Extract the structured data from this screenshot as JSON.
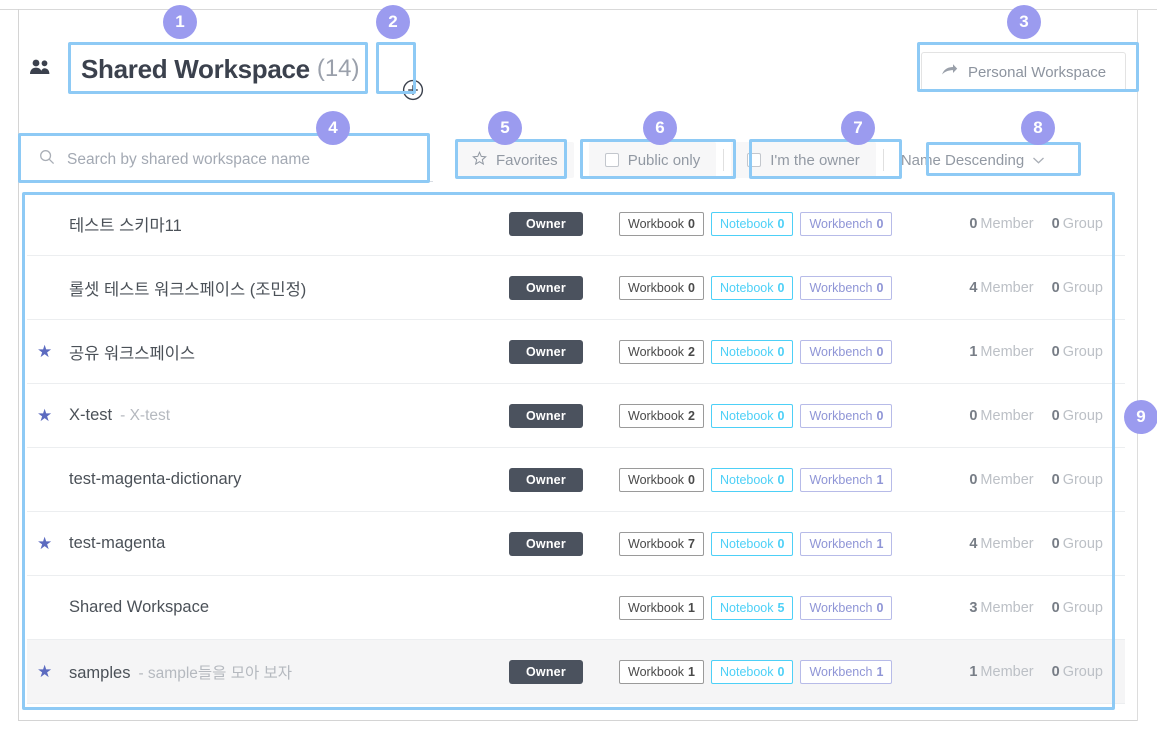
{
  "header": {
    "people_icon": "people-icon",
    "title": "Shared Workspace",
    "count": "(14)",
    "add_icon": "⊕",
    "personal_workspace_label": "Personal Workspace",
    "personal_workspace_icon": "➔"
  },
  "filters": {
    "search_placeholder": "Search by shared workspace name",
    "search_value": "",
    "search_icon": "⚲",
    "favorites_label": "Favorites",
    "favorites_icon": "☆",
    "public_only_label": "Public only",
    "public_only_checked": false,
    "im_the_owner_label": "I'm the owner",
    "im_the_owner_checked": false,
    "sort_label": "Name Descending",
    "sort_caret": "⌄"
  },
  "list": {
    "labels": {
      "workbook": "Workbook",
      "notebook": "Notebook",
      "workbench": "Workbench",
      "member": "Member",
      "group": "Group",
      "owner": "Owner",
      "star": "★"
    },
    "rows": [
      {
        "name": "테스트 스키마11",
        "desc": "",
        "favorite": false,
        "role": "Owner",
        "workbook": "0",
        "notebook": "0",
        "workbench": "0",
        "member": "0",
        "group": "0",
        "hovered": false
      },
      {
        "name": "롤셋 테스트 워크스페이스 (조민정)",
        "desc": "",
        "favorite": false,
        "role": "Owner",
        "workbook": "0",
        "notebook": "0",
        "workbench": "0",
        "member": "4",
        "group": "0",
        "hovered": false
      },
      {
        "name": "공유 워크스페이스",
        "desc": "",
        "favorite": true,
        "role": "Owner",
        "workbook": "2",
        "notebook": "0",
        "workbench": "0",
        "member": "1",
        "group": "0",
        "hovered": false
      },
      {
        "name": "X-test",
        "desc": "- X-test",
        "favorite": true,
        "role": "Owner",
        "workbook": "2",
        "notebook": "0",
        "workbench": "0",
        "member": "0",
        "group": "0",
        "hovered": false
      },
      {
        "name": "test-magenta-dictionary",
        "desc": "",
        "favorite": false,
        "role": "Owner",
        "workbook": "0",
        "notebook": "0",
        "workbench": "1",
        "member": "0",
        "group": "0",
        "hovered": false
      },
      {
        "name": "test-magenta",
        "desc": "",
        "favorite": true,
        "role": "Owner",
        "workbook": "7",
        "notebook": "0",
        "workbench": "1",
        "member": "4",
        "group": "0",
        "hovered": false
      },
      {
        "name": "Shared Workspace",
        "desc": "",
        "favorite": false,
        "role": "",
        "workbook": "1",
        "notebook": "5",
        "workbench": "0",
        "member": "3",
        "group": "0",
        "hovered": false
      },
      {
        "name": "samples",
        "desc": "- sample들을 모아 보자",
        "favorite": true,
        "role": "Owner",
        "workbook": "1",
        "notebook": "0",
        "workbench": "1",
        "member": "1",
        "group": "0",
        "hovered": true
      }
    ]
  },
  "annotations": {
    "accent_box_color": "#8ecaf5",
    "badge_color": "#9b9bef",
    "items": [
      {
        "n": "1",
        "target": "workspace-title"
      },
      {
        "n": "2",
        "target": "add-workspace-button"
      },
      {
        "n": "3",
        "target": "personal-workspace-button"
      },
      {
        "n": "4",
        "target": "search-input"
      },
      {
        "n": "5",
        "target": "favorites-filter"
      },
      {
        "n": "6",
        "target": "public-only-filter"
      },
      {
        "n": "7",
        "target": "im-the-owner-filter"
      },
      {
        "n": "8",
        "target": "sort-select"
      },
      {
        "n": "9",
        "target": "workspace-list"
      }
    ]
  }
}
